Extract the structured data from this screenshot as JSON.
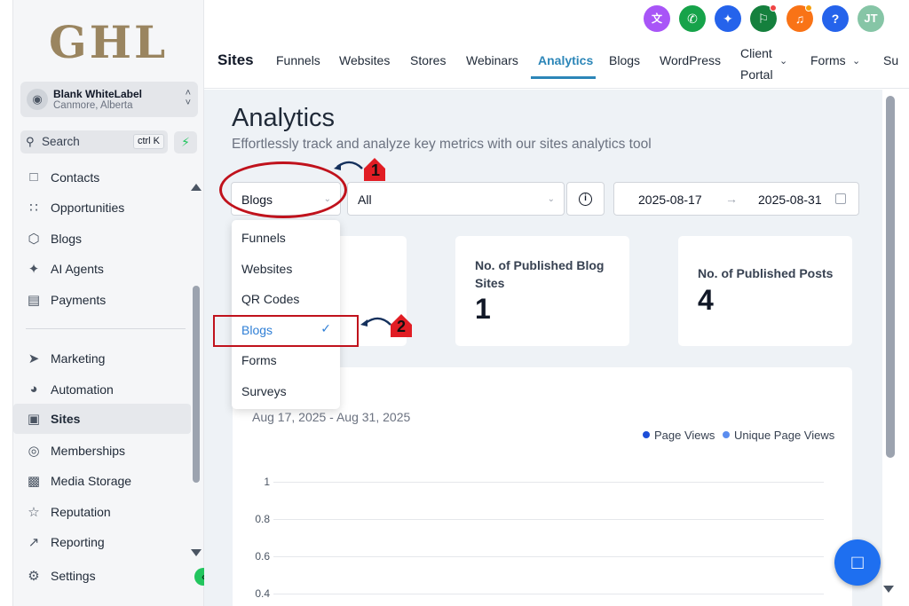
{
  "sidebar": {
    "logo": "GHL",
    "account": {
      "name": "Blank WhiteLabel",
      "location": "Canmore, Alberta"
    },
    "search": {
      "label": "Search",
      "shortcut": "ctrl K"
    },
    "items": [
      {
        "label": "Contacts",
        "icon": "contacts-icon"
      },
      {
        "label": "Opportunities",
        "icon": "opportunities-icon"
      },
      {
        "label": "Blogs",
        "icon": "blogs-icon"
      },
      {
        "label": "AI Agents",
        "icon": "ai-agents-icon"
      },
      {
        "label": "Payments",
        "icon": "payments-icon"
      },
      {
        "label": "Marketing",
        "icon": "marketing-icon"
      },
      {
        "label": "Automation",
        "icon": "automation-icon"
      },
      {
        "label": "Sites",
        "icon": "sites-icon",
        "active": true
      },
      {
        "label": "Memberships",
        "icon": "memberships-icon"
      },
      {
        "label": "Media Storage",
        "icon": "media-storage-icon"
      },
      {
        "label": "Reputation",
        "icon": "reputation-icon"
      },
      {
        "label": "Reporting",
        "icon": "reporting-icon"
      },
      {
        "label": "Settings",
        "icon": "settings-icon"
      }
    ]
  },
  "header": {
    "section": "Sites",
    "avatar_initials": "JT",
    "help_label": "?",
    "tabs": [
      {
        "label": "Funnels"
      },
      {
        "label": "Websites"
      },
      {
        "label": "Stores"
      },
      {
        "label": "Webinars"
      },
      {
        "label": "Analytics",
        "active": true
      },
      {
        "label": "Blogs"
      },
      {
        "label": "WordPress"
      },
      {
        "label_line1": "Client",
        "label_line2": "Portal"
      },
      {
        "label": "Forms"
      },
      {
        "label": "Su"
      }
    ],
    "icon_colors": {
      "translate": "#a855f7",
      "phone": "#16a34a",
      "sparkle": "#2563eb",
      "megaphone": "#15803d",
      "bell": "#f97316",
      "help": "#2563eb",
      "avatar": "#86c5a6"
    }
  },
  "main": {
    "title": "Analytics",
    "subtitle": "Effortlessly track and analyze key metrics with our sites analytics tool",
    "type_select": {
      "value": "Blogs"
    },
    "site_select": {
      "value": "All"
    },
    "date_range": {
      "start": "2025-08-17",
      "arrow": "→",
      "end": "2025-08-31"
    },
    "stats": [
      {
        "label": "No. of Published Blog Sites",
        "value": "1"
      },
      {
        "label": "No. of Published Posts",
        "value": "4"
      }
    ],
    "chart": {
      "range": "Aug 17, 2025 - Aug 31, 2025",
      "legend": [
        {
          "label": "Page Views",
          "color": "#1d4ed8"
        },
        {
          "label": "Unique Page Views",
          "color": "#5b8def"
        }
      ]
    }
  },
  "dropdown": {
    "options": [
      {
        "label": "Funnels"
      },
      {
        "label": "Websites"
      },
      {
        "label": "QR Codes"
      },
      {
        "label": "Blogs",
        "selected": true
      },
      {
        "label": "Forms"
      },
      {
        "label": "Surveys"
      }
    ]
  },
  "annotations": {
    "step1": "1",
    "step2": "2"
  },
  "chart_data": {
    "type": "line",
    "title": "",
    "xlabel": "",
    "ylabel": "",
    "y_ticks": [
      "1",
      "0.8",
      "0.6",
      "0.4"
    ],
    "ylim": [
      0,
      1
    ],
    "series": [
      {
        "name": "Page Views",
        "values": []
      },
      {
        "name": "Unique Page Views",
        "values": []
      }
    ],
    "legend_position": "top-right",
    "grid": true
  }
}
